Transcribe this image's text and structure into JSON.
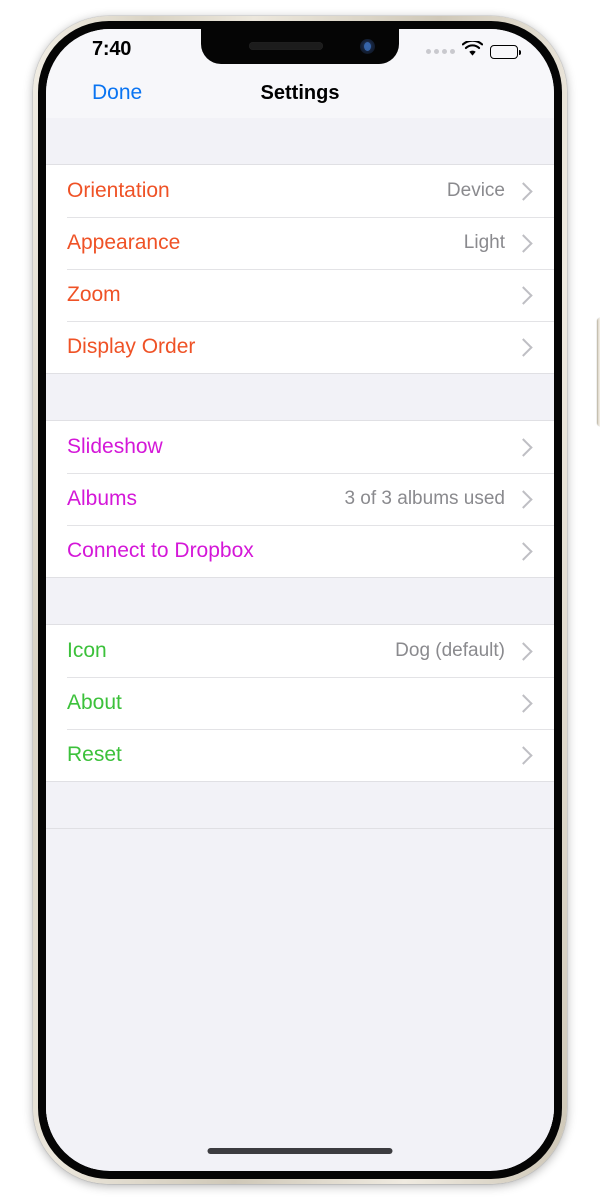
{
  "status_bar": {
    "time": "7:40",
    "signal_icon": "signal-dots-icon",
    "wifi_icon": "wifi-icon",
    "battery_icon": "battery-full-icon"
  },
  "nav_bar": {
    "done_label": "Done",
    "title": "Settings",
    "done_color": "#0a74f2"
  },
  "colors": {
    "orange": "#ef5226",
    "magenta": "#d417d8",
    "green": "#3cc13b",
    "value_gray": "#8a8a8e",
    "group_background": "#f2f2f7",
    "row_background": "#ffffff"
  },
  "groups": [
    {
      "name": "display-group",
      "color_class": "c-orange",
      "rows": [
        {
          "label": "Orientation",
          "value": "Device",
          "chevron": "chevron-right-icon"
        },
        {
          "label": "Appearance",
          "value": "Light",
          "chevron": "chevron-right-icon"
        },
        {
          "label": "Zoom",
          "value": "",
          "chevron": "chevron-right-icon"
        },
        {
          "label": "Display Order",
          "value": "",
          "chevron": "chevron-right-icon"
        }
      ]
    },
    {
      "name": "content-group",
      "color_class": "c-magenta",
      "rows": [
        {
          "label": "Slideshow",
          "value": "",
          "chevron": "chevron-right-icon"
        },
        {
          "label": "Albums",
          "value": "3 of 3 albums used",
          "chevron": "chevron-right-icon"
        },
        {
          "label": "Connect to Dropbox",
          "value": "",
          "chevron": "chevron-right-icon"
        }
      ]
    },
    {
      "name": "app-group",
      "color_class": "c-green",
      "rows": [
        {
          "label": "Icon",
          "value": "Dog (default)",
          "chevron": "chevron-right-icon"
        },
        {
          "label": "About",
          "value": "",
          "chevron": "chevron-right-icon"
        },
        {
          "label": "Reset",
          "value": "",
          "chevron": "chevron-right-icon"
        }
      ]
    }
  ]
}
